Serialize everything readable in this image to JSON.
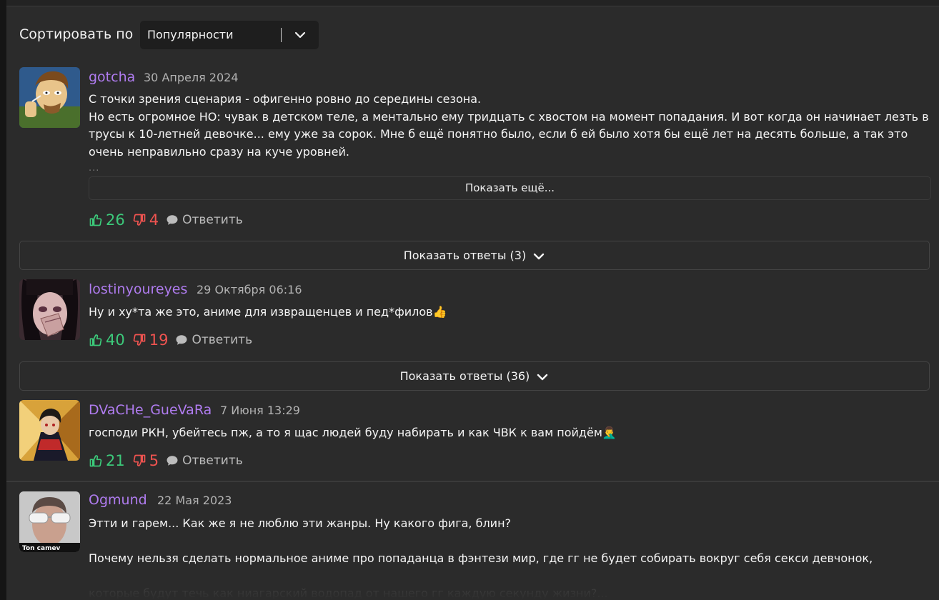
{
  "sort": {
    "label": "Сортировать по",
    "selected": "Популярности"
  },
  "comments": [
    {
      "author": "gotcha",
      "date": "30 Апреля 2024",
      "lines": [
        "С точки зрения сценария - офигенно ровно до середины сезона.",
        "Но есть огромное НО: чувак в детском теле, а ментально ему тридцать с хвостом на момент попадания. И вот когда он начинает лезть в",
        "трусы к 10-летней девочке... ему уже за сорок. Мне б ещё понятно было, если б ей было хотя бы ещё лет на десять больше, а так это",
        "очень неправильно сразу на куче уровней."
      ],
      "ellipsis": "...",
      "show_more": "Показать ещё...",
      "likes": "26",
      "dislikes": "4",
      "reply": "Ответить",
      "show_replies": "Показать ответы (3)"
    },
    {
      "author": "lostinyoureyes",
      "date": "29 Октября 06:16",
      "lines": [
        "Ну и ху*та же это, аниме для извращенцев и пед*филов👍"
      ],
      "likes": "40",
      "dislikes": "19",
      "reply": "Ответить",
      "show_replies": "Показать ответы (36)"
    },
    {
      "author": "DVaCHe_GueVaRa",
      "date": "7 Июня 13:29",
      "lines": [
        "господи РКН, убейтесь пж, а то я щас людей буду набирать и как ЧВК к вам пойдём🤦‍♂️"
      ],
      "likes": "21",
      "dislikes": "5",
      "reply": "Ответить"
    },
    {
      "author": "Ogmund",
      "date": "22 Мая 2023",
      "avatar_caption": "Ton camev",
      "lines": [
        "Этти и гарем... Как же я не люблю эти жанры. Ну какого фига, блин?",
        "",
        "Почему нельзя сделать нормальное аниме про попаданца в фэнтези мир, где гг не будет собирать вокруг себя секси девчонок,",
        "",
        "которые будут течь как ниагарский водопад от нашего гг каждую секунду жизни?..."
      ]
    }
  ],
  "colors": {
    "author": "#b07cf0",
    "like": "#3cc97a",
    "dislike": "#ef5350",
    "background": "#2b2b2b"
  },
  "icons": {
    "like": "thumbs-up-icon",
    "dislike": "thumbs-down-icon",
    "reply": "speech-bubble-icon",
    "chevron": "chevron-down-icon"
  }
}
